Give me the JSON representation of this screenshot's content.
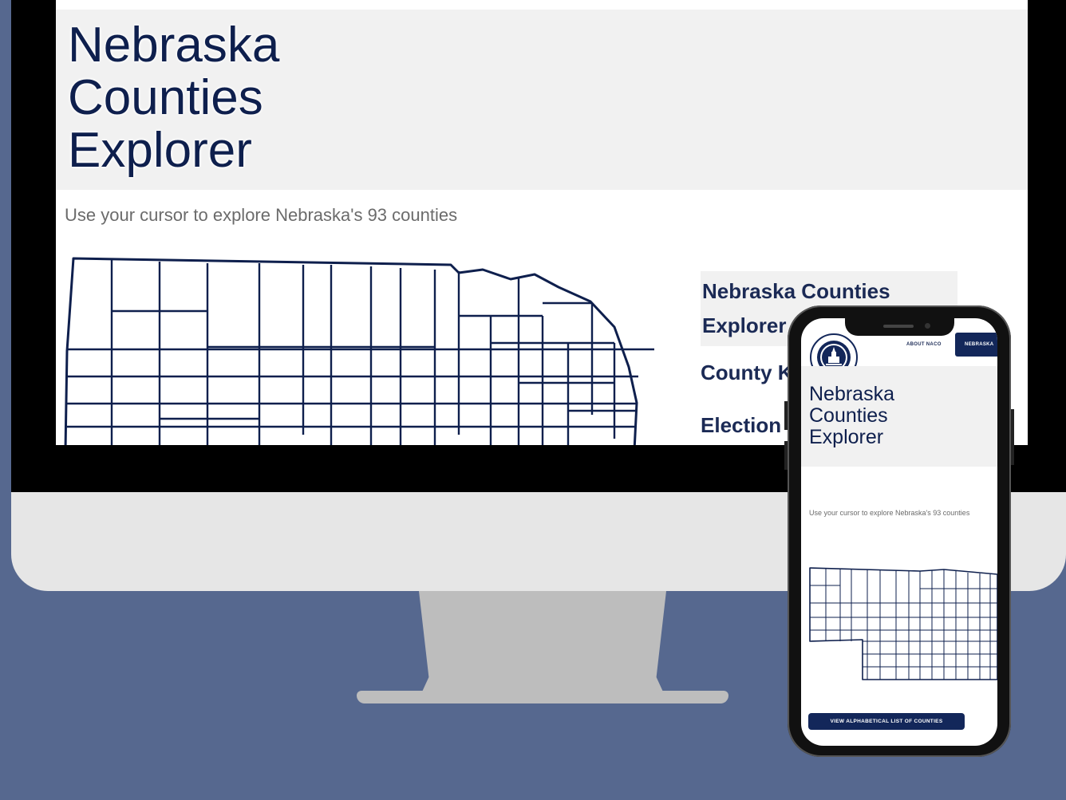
{
  "desktop": {
    "page_title": "Nebraska Counties Explorer",
    "subtitle": "Use your cursor to explore Nebraska's 93 counties",
    "side_menu": [
      {
        "label": "Nebraska Counties Explorer"
      },
      {
        "label": "County K"
      },
      {
        "label": "Election"
      }
    ]
  },
  "phone": {
    "nav_about": "ABOUT NACO",
    "nav_button": "NEBRASKA",
    "page_title": "Nebraska Counties Explorer",
    "subtitle": "Use your cursor to explore Nebraska's 93 counties",
    "list_button": "VIEW ALPHABETICAL LIST OF COUNTIES"
  },
  "colors": {
    "background": "#56688f",
    "navy": "#13275a",
    "map_stroke": "#0e1f4d"
  }
}
